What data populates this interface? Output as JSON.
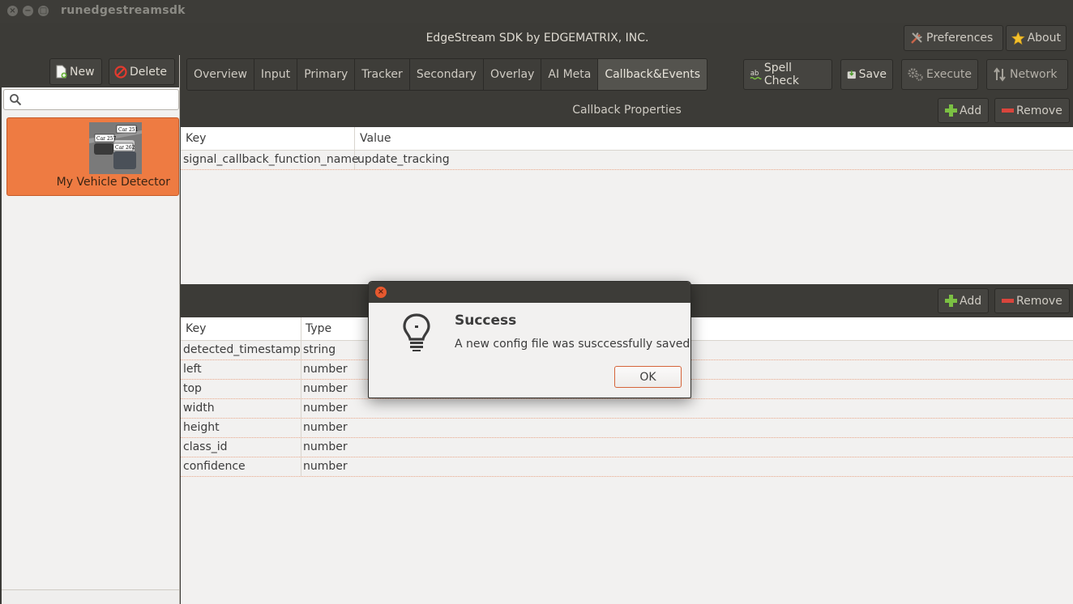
{
  "window": {
    "title": "runedgestreamsdk",
    "close_glyph": "×",
    "minimize_glyph": "−",
    "maximize_glyph": "□"
  },
  "header": {
    "title": "EdgeStream SDK by EDGEMATRIX, INC.",
    "preferences_label": "Preferences",
    "about_label": "About"
  },
  "sidebar": {
    "new_label": "New",
    "delete_label": "Delete",
    "search": {
      "value": "",
      "placeholder": ""
    },
    "projects": [
      {
        "name": "My Vehicle Detector",
        "thumb_labels": [
          "Car 251",
          "Car 257",
          "Car 262"
        ]
      }
    ]
  },
  "tabs": [
    {
      "label": "Overview",
      "active": false
    },
    {
      "label": "Input",
      "active": false
    },
    {
      "label": "Primary",
      "active": false
    },
    {
      "label": "Tracker",
      "active": false
    },
    {
      "label": "Secondary",
      "active": false
    },
    {
      "label": "Overlay",
      "active": false
    },
    {
      "label": "AI Meta",
      "active": false
    },
    {
      "label": "Callback&Events",
      "active": true
    }
  ],
  "toolbar": {
    "spellcheck_label": "Spell Check",
    "save_label": "Save",
    "execute_label": "Execute",
    "network_label": "Network"
  },
  "callback_properties": {
    "title": "Callback Properties",
    "add_label": "Add",
    "remove_label": "Remove",
    "columns": [
      "Key",
      "Value"
    ],
    "rows": [
      [
        "signal_callback_function_name",
        "update_tracking"
      ]
    ]
  },
  "event_properties": {
    "add_label": "Add",
    "remove_label": "Remove",
    "columns": [
      "Key",
      "Type"
    ],
    "rows": [
      [
        "detected_timestamp",
        "string"
      ],
      [
        "left",
        "number"
      ],
      [
        "top",
        "number"
      ],
      [
        "width",
        "number"
      ],
      [
        "height",
        "number"
      ],
      [
        "class_id",
        "number"
      ],
      [
        "confidence",
        "number"
      ]
    ]
  },
  "dialog": {
    "close_glyph": "×",
    "heading": "Success",
    "message": "A new config file was susccessfully saved",
    "ok_label": "OK"
  },
  "colors": {
    "accent": "#ee7b42",
    "chrome": "#3c3b37",
    "background": "#f2f1f0",
    "close": "#e6582e"
  }
}
